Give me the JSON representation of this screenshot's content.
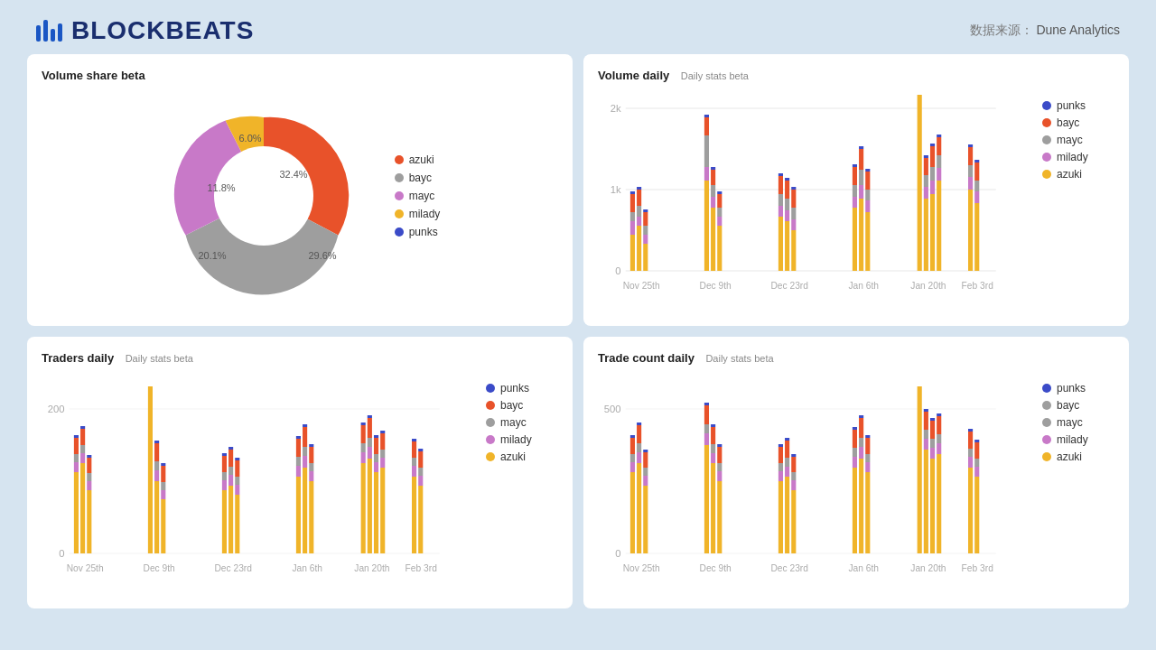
{
  "header": {
    "logo_text": "BLOCKBEATS",
    "data_source_label": "数据来源：",
    "data_source_value": "Dune Analytics"
  },
  "charts": {
    "volume_share": {
      "title": "Volume share beta",
      "segments": [
        {
          "label": "azuki",
          "value": 29.6,
          "color": "#e8522a",
          "startAngle": 0
        },
        {
          "label": "bayc",
          "value": 32.4,
          "color": "#9e9e9e",
          "startAngle": 106.56
        },
        {
          "label": "mayc",
          "value": 20.1,
          "color": "#c879c8",
          "startAngle": 223.2
        },
        {
          "label": "milady",
          "value": 11.8,
          "color": "#f0b429",
          "startAngle": 295.56
        },
        {
          "label": "punks",
          "value": 6.0,
          "color": "#3b4bc8",
          "startAngle": 338.04
        }
      ],
      "legend": [
        {
          "label": "azuki",
          "color": "#e8522a"
        },
        {
          "label": "bayc",
          "color": "#9e9e9e"
        },
        {
          "label": "mayc",
          "color": "#c879c8"
        },
        {
          "label": "milady",
          "color": "#f0b429"
        },
        {
          "label": "punks",
          "color": "#3b4bc8"
        }
      ]
    },
    "volume_daily": {
      "title": "Volume daily",
      "subtitle": "Daily stats beta",
      "y_labels": [
        "2k",
        "1k",
        "0"
      ],
      "x_labels": [
        "Nov 25th",
        "Dec 9th",
        "Dec 23rd",
        "Jan 6th",
        "Jan 20th",
        "Feb 3rd"
      ],
      "legend": [
        {
          "label": "punks",
          "color": "#3b4bc8"
        },
        {
          "label": "bayc",
          "color": "#e8522a"
        },
        {
          "label": "mayc",
          "color": "#9e9e9e"
        },
        {
          "label": "milady",
          "color": "#c879c8"
        },
        {
          "label": "azuki",
          "color": "#f0b429"
        }
      ]
    },
    "traders_daily": {
      "title": "Traders daily",
      "subtitle": "Daily stats beta",
      "y_labels": [
        "200",
        "0"
      ],
      "x_labels": [
        "Nov 25th",
        "Dec 9th",
        "Dec 23rd",
        "Jan 6th",
        "Jan 20th",
        "Feb 3rd"
      ],
      "legend": [
        {
          "label": "punks",
          "color": "#3b4bc8"
        },
        {
          "label": "bayc",
          "color": "#e8522a"
        },
        {
          "label": "mayc",
          "color": "#9e9e9e"
        },
        {
          "label": "milady",
          "color": "#c879c8"
        },
        {
          "label": "azuki",
          "color": "#f0b429"
        }
      ]
    },
    "trade_count": {
      "title": "Trade count daily",
      "subtitle": "Daily stats beta",
      "y_labels": [
        "500",
        "0"
      ],
      "x_labels": [
        "Nov 25th",
        "Dec 9th",
        "Dec 23rd",
        "Jan 6th",
        "Jan 20th",
        "Feb 3rd"
      ],
      "legend": [
        {
          "label": "punks",
          "color": "#3b4bc8"
        },
        {
          "label": "bayc",
          "color": "#9e9e9e"
        },
        {
          "label": "mayc",
          "color": "#9e9e9e"
        },
        {
          "label": "milady",
          "color": "#c879c8"
        },
        {
          "label": "azuki",
          "color": "#f0b429"
        }
      ]
    }
  }
}
